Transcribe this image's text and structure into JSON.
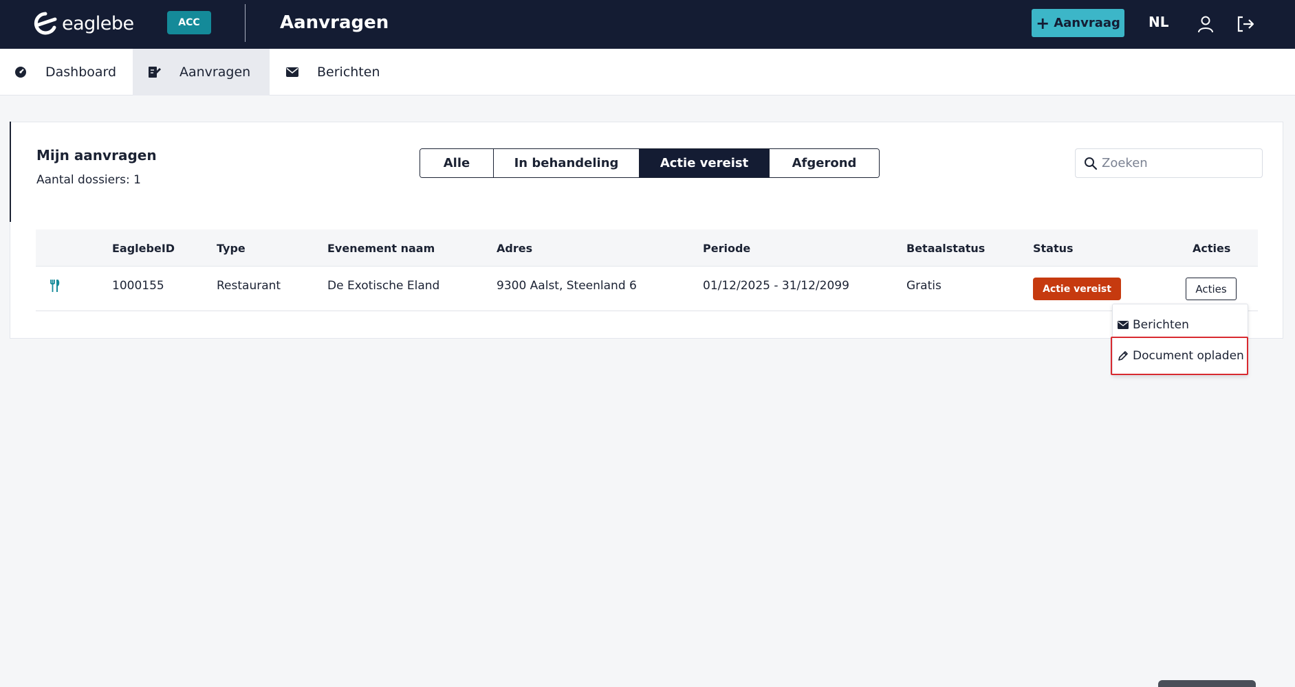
{
  "header": {
    "logo_text": "eaglebe",
    "env_badge": "ACC",
    "page_title": "Aanvragen",
    "new_request_label": "Aanvraag",
    "language": "NL",
    "colors": {
      "background": "#141c33",
      "accent": "#3cb6c8",
      "badge": "#148a99"
    }
  },
  "nav": {
    "items": [
      {
        "label": "Dashboard",
        "icon": "dashboard-gauge-icon"
      },
      {
        "label": "Aanvragen",
        "icon": "edit-document-icon",
        "active": true
      },
      {
        "label": "Berichten",
        "icon": "envelope-icon"
      }
    ]
  },
  "card": {
    "title": "Mijn aanvragen",
    "subtitle": "Aantal dossiers: 1"
  },
  "filters": {
    "items": [
      "Alle",
      "In behandeling",
      "Actie vereist",
      "Afgerond"
    ],
    "active": "Actie vereist"
  },
  "search": {
    "placeholder": "Zoeken",
    "value": ""
  },
  "table": {
    "columns": [
      "EaglebeID",
      "Type",
      "Evenement naam",
      "Adres",
      "Periode",
      "Betaalstatus",
      "Status",
      "Acties"
    ],
    "rows": [
      {
        "type_icon": "utensils-icon",
        "id": "1000155",
        "type": "Restaurant",
        "naam": "De Exotische Eland",
        "adres": "9300 Aalst, Steenland 6",
        "periode": "01/12/2025 - 31/12/2099",
        "betaalstatus": "Gratis",
        "status": "Actie vereist",
        "status_color": "#c63a0f",
        "acties_label": "Acties"
      }
    ]
  },
  "dropdown": {
    "items": [
      {
        "label": "Berichten",
        "icon": "envelope-icon"
      },
      {
        "label": "Document opladen",
        "icon": "pencil-icon"
      }
    ],
    "highlighted": "Document opladen"
  }
}
